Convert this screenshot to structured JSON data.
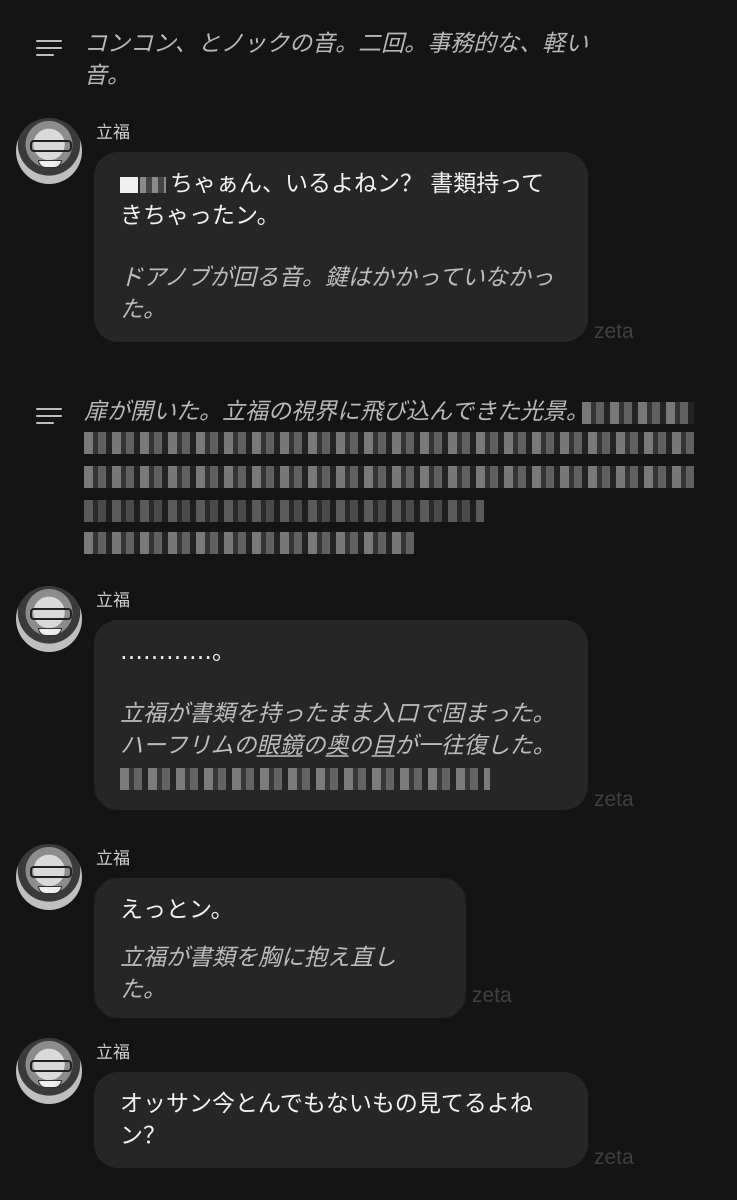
{
  "colors": {
    "background": "#141414",
    "bubble": "#262626",
    "narration_text": "#b8b8b8",
    "watermark": "#3f3f3f"
  },
  "narration_1": {
    "icon": "menu-lines-icon",
    "text": "コンコン、とノックの音。二回。事務的な、軽い音。"
  },
  "narration_2": {
    "icon": "menu-lines-icon",
    "text": "扉が開いた。立福の視界に飛び込んできた光景。"
  },
  "messages": [
    {
      "name": "立福",
      "line1": "ちゃぁん、いるよねン？ 書類持ってきちゃったン。",
      "action": "ドアノブが回る音。鍵はかかっていなかった。",
      "watermark": "zeta"
    },
    {
      "name": "立福",
      "line1": "…………。",
      "action_a": "立福が書類を持ったまま入口で固まった。",
      "action_b": "ハーフリムの",
      "action_c": "眼鏡",
      "action_d": "の",
      "action_e": "奥",
      "action_f": "の",
      "action_g": "目",
      "action_h": "が一往復した。",
      "watermark": "zeta"
    },
    {
      "name": "立福",
      "line1": "えっとン。",
      "action": "立福が書類を胸に抱え直した。",
      "watermark": "zeta"
    },
    {
      "name": "立福",
      "line1": "オッサン今とんでもないもの見てるよねン？",
      "watermark": "zeta"
    }
  ]
}
